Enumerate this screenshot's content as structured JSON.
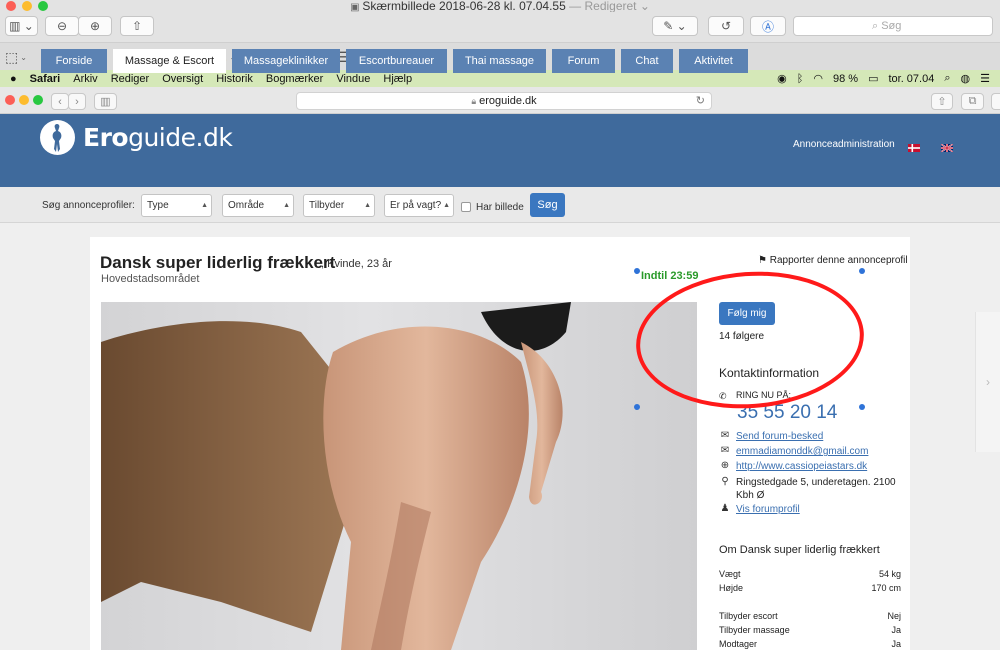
{
  "preview": {
    "title_file": "Skærmbillede 2018-06-28 kl. 07.04.55",
    "title_state": "— Redigeret",
    "search_placeholder": "Søg"
  },
  "menubar": {
    "items": [
      "Safari",
      "Arkiv",
      "Rediger",
      "Oversigt",
      "Historik",
      "Bogmærker",
      "Vindue",
      "Hjælp"
    ],
    "battery": "98 %",
    "clock": "tor. 07.04"
  },
  "safari": {
    "url": "eroguide.dk"
  },
  "site": {
    "logo_text_a": "Ero",
    "logo_text_b": "guide.dk",
    "admin_link": "Annonceadministration",
    "tabs": [
      "Forside",
      "Massage & Escort",
      "Massageklinikker",
      "Escortbureauer",
      "Thai massage",
      "Forum",
      "Chat",
      "Aktivitet"
    ],
    "active_tab": "Massage & Escort"
  },
  "search": {
    "label": "Søg annonceprofiler:",
    "selects": [
      "Type",
      "Område",
      "Tilbyder",
      "Er på vagt?"
    ],
    "checkbox_label": "Har billede",
    "button": "Søg"
  },
  "ad": {
    "title": "Dansk super liderlig frækkert",
    "subtitle": ", Kvinde, 23 år",
    "region": "Hovedstadsområdet",
    "report": "Rapporter denne annonceprofil",
    "until": "Indtil 23:59",
    "follow_button": "Følg mig",
    "followers": "14 følgere",
    "contact_heading": "Kontaktinformation",
    "call_label": "RING NU PÅ:",
    "phone": "35 55 20 14",
    "contacts": [
      {
        "icon": "envelope-icon",
        "text": "Send forum-besked",
        "link": true
      },
      {
        "icon": "envelope-icon",
        "text": "emmadiamonddk@gmail.com",
        "link": true
      },
      {
        "icon": "globe-icon",
        "text": "http://www.cassiopeiastars.dk",
        "link": true
      },
      {
        "icon": "map-marker-icon",
        "text": "Ringstedgade 5, underetagen. 2100 Kbh Ø",
        "link": false
      },
      {
        "icon": "user-icon",
        "text": "Vis forumprofil",
        "link": true
      }
    ],
    "about_heading": "Om Dansk super liderlig frækkert",
    "details": [
      {
        "label": "Vægt",
        "value": "54 kg"
      },
      {
        "label": "Højde",
        "value": "170 cm"
      },
      {
        "label": "Tilbyder escort",
        "value": "Nej"
      },
      {
        "label": "Tilbyder massage",
        "value": "Ja"
      },
      {
        "label": "Modtager",
        "value": "Ja"
      }
    ]
  },
  "colors": {
    "header_blue": "#3f6a9c",
    "tab_blue": "#5b82b3",
    "button_blue": "#3a77c0",
    "annotation_red": "#ff1a1a",
    "menubar_green": "#d5e8b8"
  }
}
